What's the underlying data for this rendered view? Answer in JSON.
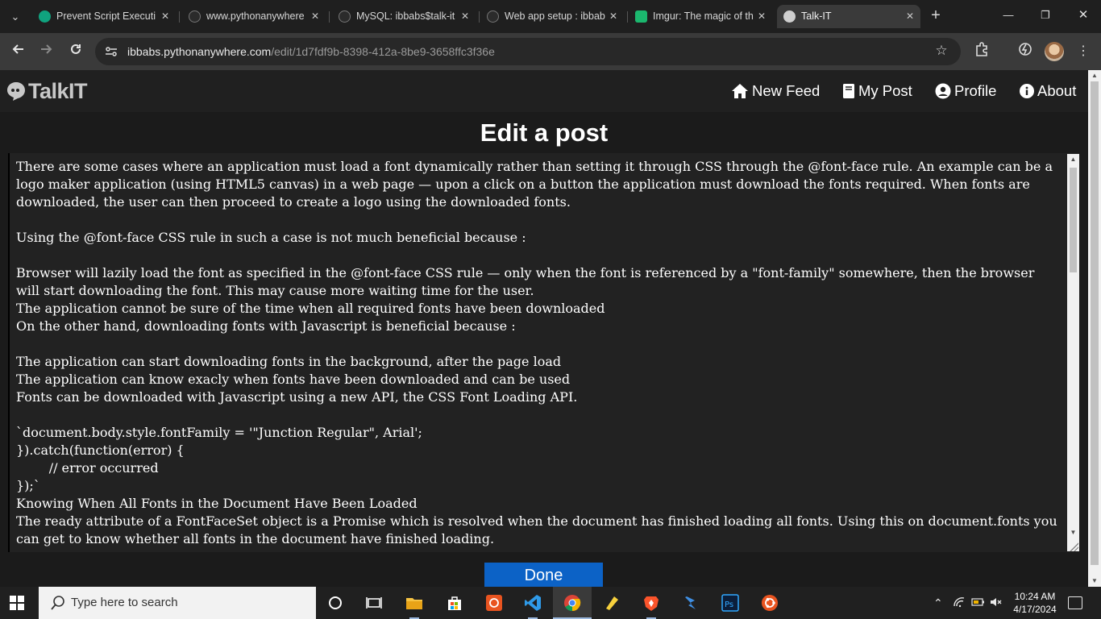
{
  "browser": {
    "tabs": [
      {
        "title": "Prevent Script Executi",
        "active": false,
        "favicon_color": "#10a37f"
      },
      {
        "title": "www.pythonanywhere",
        "active": false,
        "favicon_color": "#2b2b2b"
      },
      {
        "title": "MySQL: ibbabs$talk-it",
        "active": false,
        "favicon_color": "#2b2b2b"
      },
      {
        "title": "Web app setup : ibbab",
        "active": false,
        "favicon_color": "#2b2b2b"
      },
      {
        "title": "Imgur: The magic of th",
        "active": false,
        "favicon_color": "#1bb76e"
      },
      {
        "title": "Talk-IT",
        "active": true,
        "favicon_color": "#cfcfcf"
      }
    ],
    "close_glyph": "✕",
    "address": {
      "host": "ibbabs.pythonanywhere.com",
      "path": "/edit/1d7fdf9b-8398-412a-8be9-3658ffc3f36e"
    }
  },
  "site": {
    "logo_text": "TalkIT",
    "nav": {
      "new_feed": "New Feed",
      "my_post": "My Post",
      "profile": "Profile",
      "about": "About"
    },
    "page_title": "Edit a post",
    "post_body": "There are some cases where an application must load a font dynamically rather than setting it through CSS through the @font-face rule. An example can be a logo maker application (using HTML5 canvas) in a web page — upon a click on a button the application must download the fonts required. When fonts are downloaded, the user can then proceed to create a logo using the downloaded fonts.\n\nUsing the @font-face CSS rule in such a case is not much beneficial because :\n\nBrowser will lazily load the font as specified in the @font-face CSS rule — only when the font is referenced by a \"font-family\" somewhere, then the browser will start downloading the font. This may cause more waiting time for the user.\nThe application cannot be sure of the time when all required fonts have been downloaded\nOn the other hand, downloading fonts with Javascript is beneficial because :\n\nThe application can start downloading fonts in the background, after the page load\nThe application can know exacly when fonts have been downloaded and can be used\nFonts can be downloaded with Javascript using a new API, the CSS Font Loading API.\n\n`document.body.style.fontFamily = '\"Junction Regular\", Arial';\n}).catch(function(error) {\n\t// error occurred\n});`\nKnowing When All Fonts in the Document Have Been Loaded\nThe ready attribute of a FontFaceSet object is a Promise which is resolved when the document has finished loading all fonts. Using this on document.fonts you can get to know whether all fonts in the document have finished loading.",
    "done_label": "Done"
  },
  "taskbar": {
    "search_placeholder": "Type here to search",
    "time": "10:24 AM",
    "date": "4/17/2024"
  }
}
